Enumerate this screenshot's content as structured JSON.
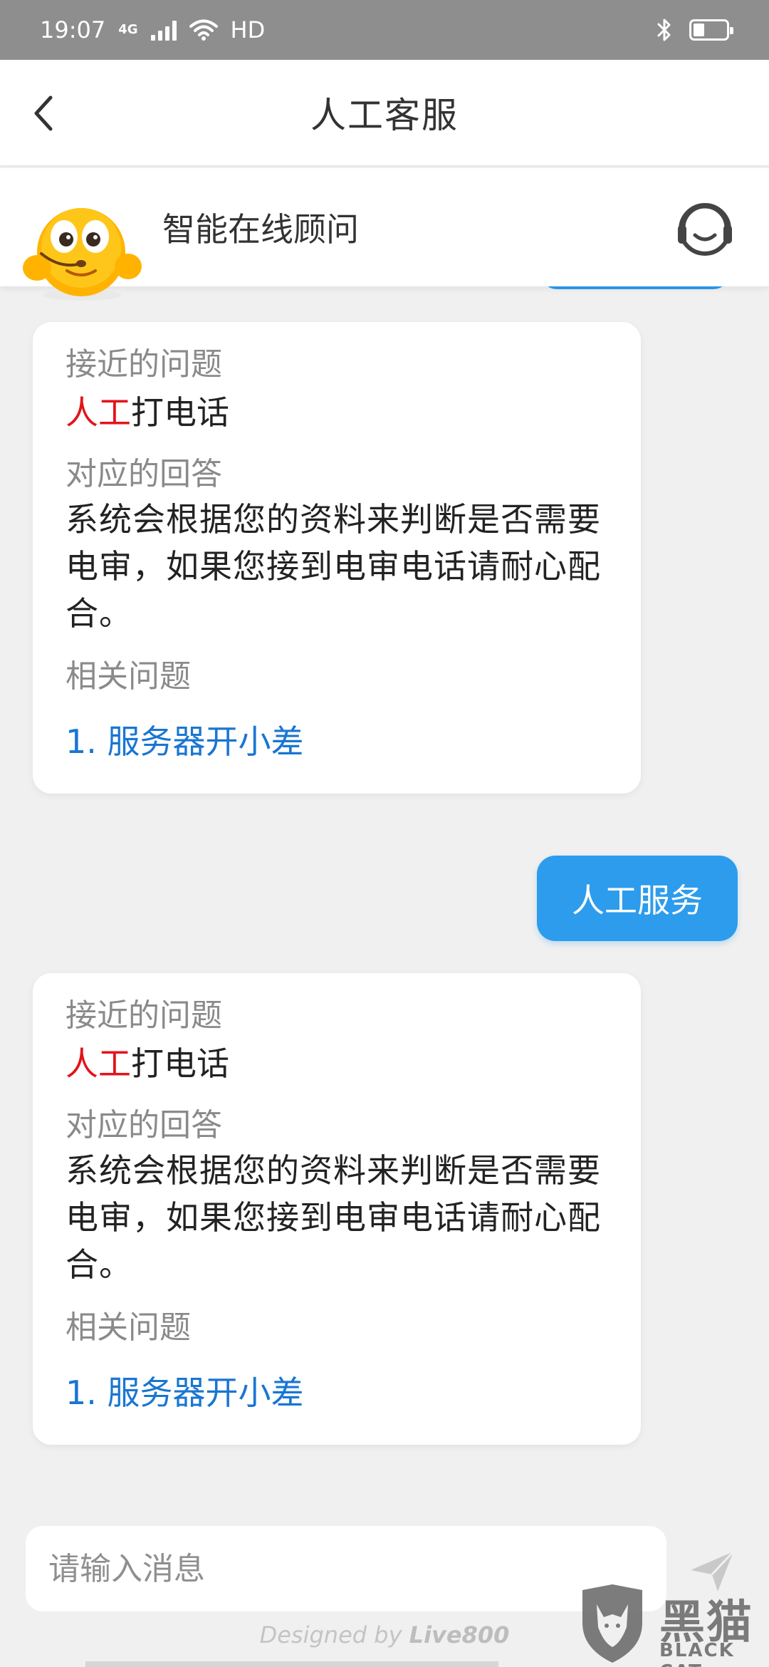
{
  "status_bar": {
    "time": "19:07",
    "network": "4G",
    "hd_label": "HD",
    "battery_level": 0.35
  },
  "nav": {
    "title": "人工客服"
  },
  "agent": {
    "name": "智能在线顾问"
  },
  "messages": [
    {
      "type": "bot_card",
      "question_label": "接近的问题",
      "question_highlight": "人工",
      "question_rest": "打电话",
      "answer_label": "对应的回答",
      "answer_text": "系统会根据您的资料来判断是否需要电审，如果您接到电审电话请耐心配合。",
      "related_label": "相关问题",
      "related_items": [
        "1. 服务器开小差"
      ]
    },
    {
      "type": "user",
      "text": "人工服务"
    },
    {
      "type": "bot_card",
      "question_label": "接近的问题",
      "question_highlight": "人工",
      "question_rest": "打电话",
      "answer_label": "对应的回答",
      "answer_text": "系统会根据您的资料来判断是否需要电审，如果您接到电审电话请耐心配合。",
      "related_label": "相关问题",
      "related_items": [
        "1. 服务器开小差"
      ]
    }
  ],
  "input": {
    "placeholder": "请输入消息"
  },
  "footer": {
    "designed_by": "Designed by",
    "brand": "Live800"
  },
  "watermark": {
    "text_cn": "黑猫",
    "text_en": "BLACK CAT"
  },
  "icons": {
    "back": "chevron-left-icon",
    "headset": "headset-icon",
    "send": "send-icon",
    "wifi": "wifi-icon",
    "bluetooth": "bluetooth-icon",
    "battery": "battery-icon"
  },
  "colors": {
    "accent": "#2d9cec",
    "highlight": "#e4131b",
    "link": "#1976d2",
    "background": "#f0f0f0"
  }
}
